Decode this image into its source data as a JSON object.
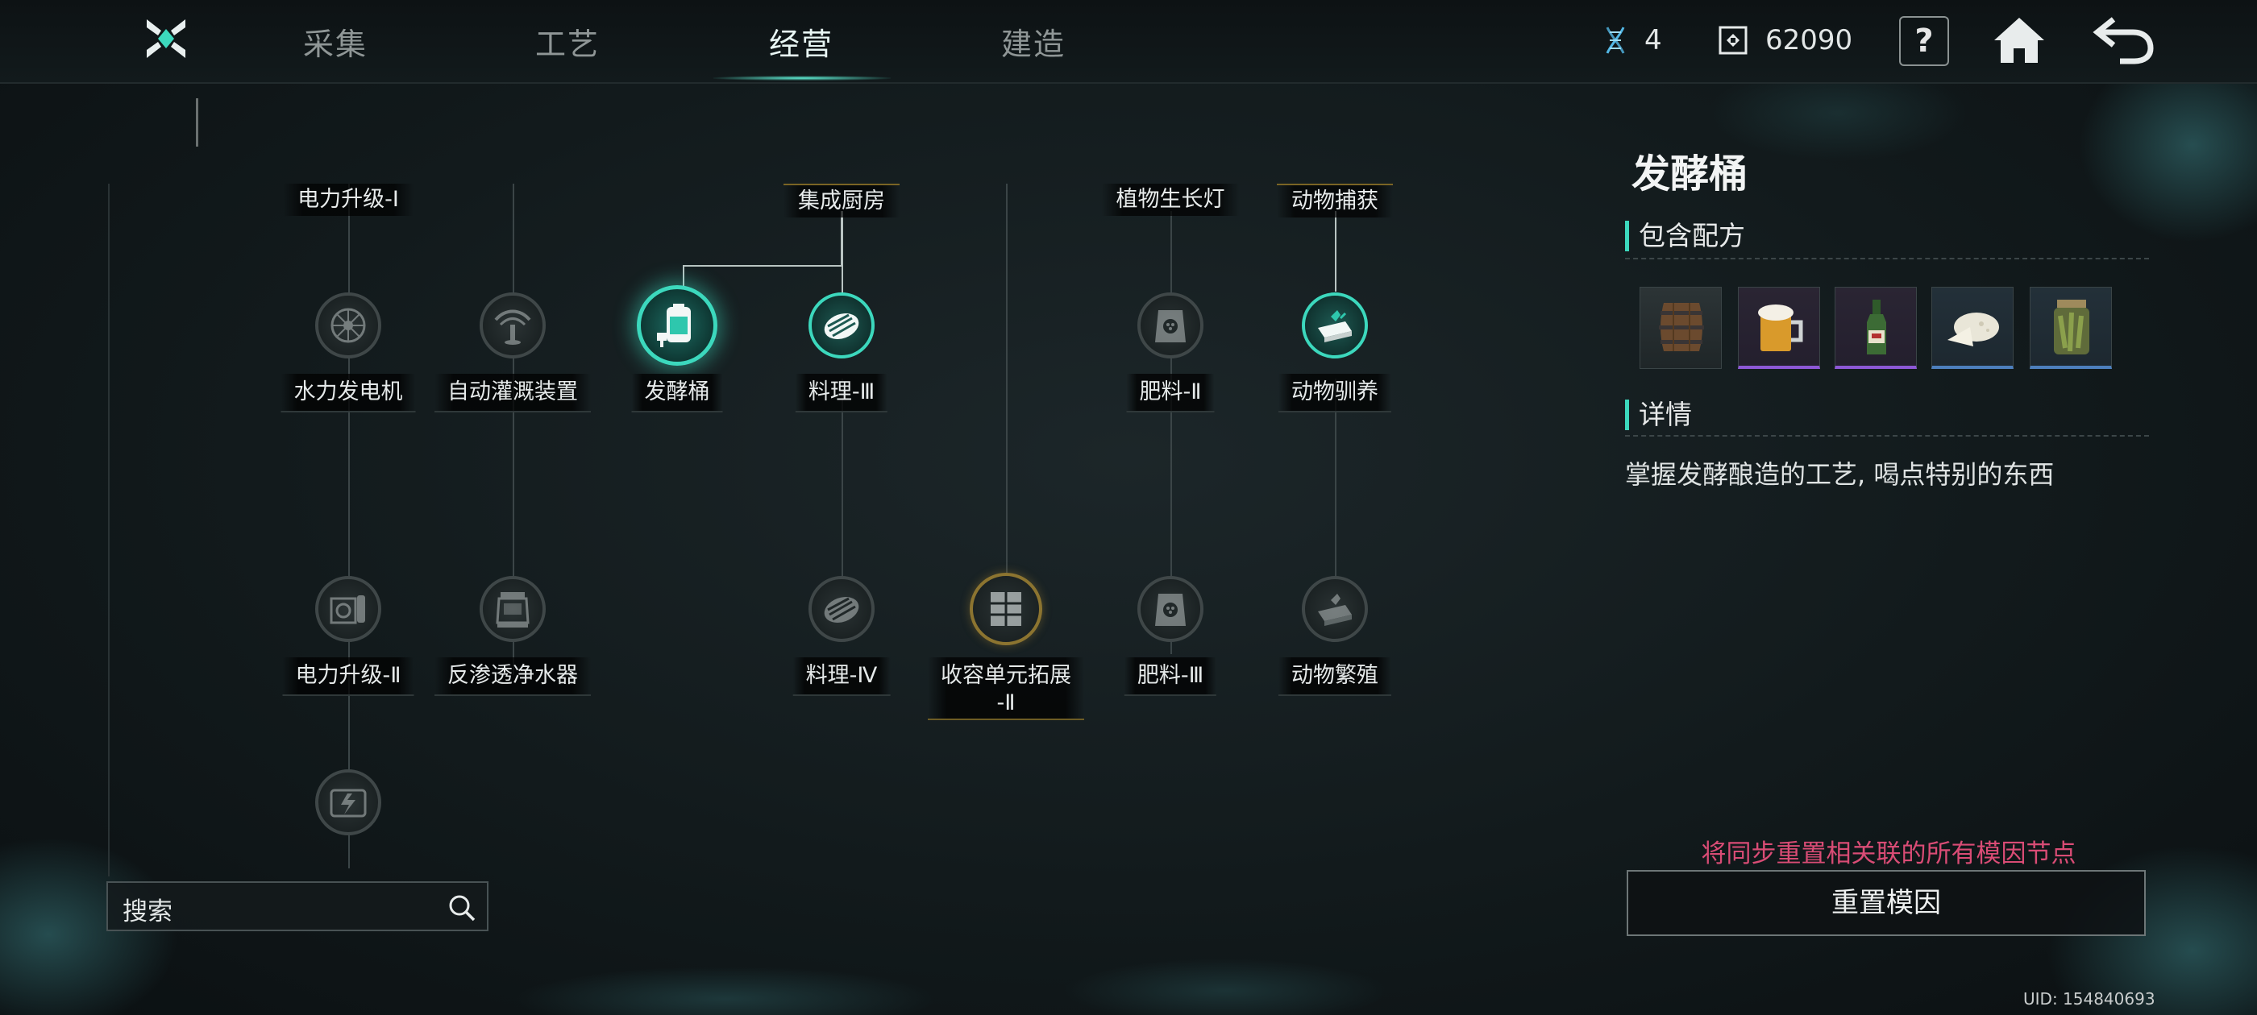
{
  "tabs": [
    {
      "label": "采集",
      "active": false
    },
    {
      "label": "工艺",
      "active": false
    },
    {
      "label": "经营",
      "active": true
    },
    {
      "label": "建造",
      "active": false
    }
  ],
  "resources": {
    "gene_points": "4",
    "currency": "62090"
  },
  "header_buttons": {
    "help": "?"
  },
  "tree": {
    "top_tags": [
      {
        "label": "电力升级-Ⅰ",
        "gold": false
      },
      {
        "label": "集成厨房",
        "gold": true
      },
      {
        "label": "植物生长灯",
        "gold": false
      },
      {
        "label": "动物捕获",
        "gold": true
      }
    ],
    "nodes": [
      {
        "id": "hydro",
        "label": "水力发电机",
        "icon": "turbine-icon",
        "state": "locked"
      },
      {
        "id": "irrigation",
        "label": "自动灌溉装置",
        "icon": "sprinkler-icon",
        "state": "locked"
      },
      {
        "id": "ferment",
        "label": "发酵桶",
        "icon": "fermentation-barrel-icon",
        "state": "selected"
      },
      {
        "id": "cook3",
        "label": "料理-Ⅲ",
        "icon": "steak-icon",
        "state": "learned"
      },
      {
        "id": "fert2",
        "label": "肥料-Ⅱ",
        "icon": "fertilizer-bag-icon",
        "state": "locked"
      },
      {
        "id": "domestic",
        "label": "动物驯养",
        "icon": "animal-feed-icon",
        "state": "learned"
      },
      {
        "id": "power2",
        "label": "电力升级-Ⅱ",
        "icon": "power-unit-icon",
        "state": "locked"
      },
      {
        "id": "ro",
        "label": "反渗透净水器",
        "icon": "water-purifier-icon",
        "state": "locked"
      },
      {
        "id": "cook4",
        "label": "料理-Ⅳ",
        "icon": "steak-icon",
        "state": "locked"
      },
      {
        "id": "storage2",
        "label": "收容单元拓展\n-Ⅱ",
        "icon": "storage-cabinet-icon",
        "state": "gold"
      },
      {
        "id": "fert3",
        "label": "肥料-Ⅲ",
        "icon": "fertilizer-bag-icon",
        "state": "locked"
      },
      {
        "id": "breed",
        "label": "动物繁殖",
        "icon": "animal-feed-icon",
        "state": "locked"
      },
      {
        "id": "generator",
        "label": "",
        "icon": "generator-icon",
        "state": "locked"
      }
    ]
  },
  "search": {
    "placeholder": "搜索"
  },
  "detail": {
    "title": "发酵桶",
    "recipes_heading": "包含配方",
    "recipes": [
      {
        "icon": "wooden-barrel-icon",
        "rarity": "common"
      },
      {
        "icon": "beer-mug-icon",
        "rarity": "epic"
      },
      {
        "icon": "bottle-icon",
        "rarity": "epic"
      },
      {
        "icon": "cheese-icon",
        "rarity": "rare"
      },
      {
        "icon": "pickle-jar-icon",
        "rarity": "rare"
      }
    ],
    "info_heading": "详情",
    "description": "掌握发酵酿造的工艺, 喝点特别的东西"
  },
  "reset": {
    "warning": "将同步重置相关联的所有模因节点",
    "button": "重置模因"
  },
  "uid": "UID: 154840693",
  "colors": {
    "accent": "#3cd8bd",
    "gold": "#8c7430",
    "warning": "#d94c75",
    "epic": "#8d58d6",
    "rare": "#4d7fbd"
  }
}
